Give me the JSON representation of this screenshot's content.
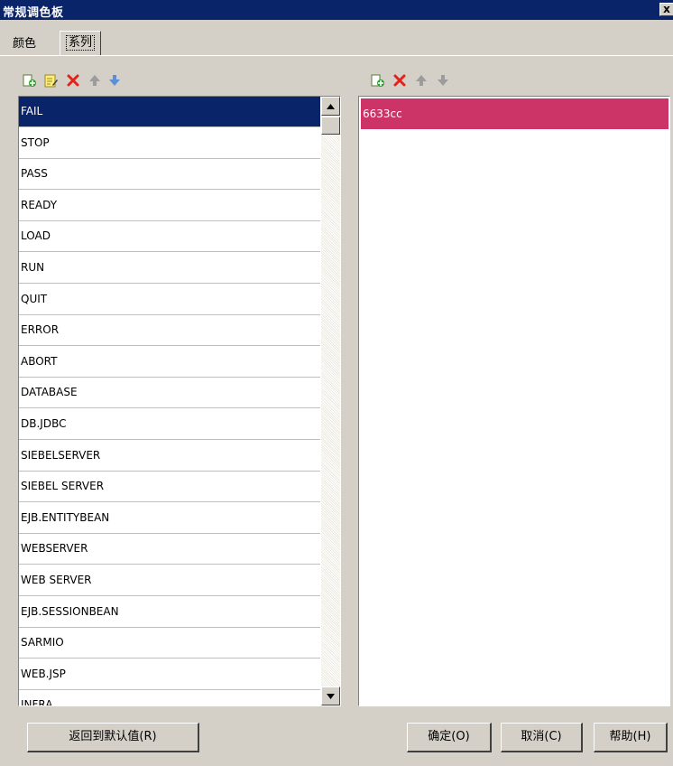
{
  "window": {
    "title": "常规调色板",
    "close_glyph": "x"
  },
  "tabs": [
    {
      "label": "颜色",
      "active": false
    },
    {
      "label": "系列",
      "active": true
    }
  ],
  "series_list": {
    "selected_index": 0,
    "items": [
      "FAIL",
      "STOP",
      "PASS",
      "READY",
      "LOAD",
      "RUN",
      "QUIT",
      "ERROR",
      "ABORT",
      "DATABASE",
      "DB.JDBC",
      "SIEBELSERVER",
      "SIEBEL SERVER",
      "EJB.ENTITYBEAN",
      "WEBSERVER",
      "WEB SERVER",
      "EJB.SESSIONBEAN",
      "SARMIO",
      "WEB.JSP",
      "INFRA"
    ]
  },
  "color_list": {
    "items": [
      {
        "label": "6633cc",
        "swatch": "#cc3366"
      }
    ]
  },
  "buttons": {
    "reset": "返回到默认值(R)",
    "ok": "确定(O)",
    "cancel": "取消(C)",
    "help": "帮助(H)"
  },
  "colors": {
    "titlebar": "#0a246a",
    "selection": "#0a246a",
    "dialog_bg": "#d4d0c8"
  }
}
